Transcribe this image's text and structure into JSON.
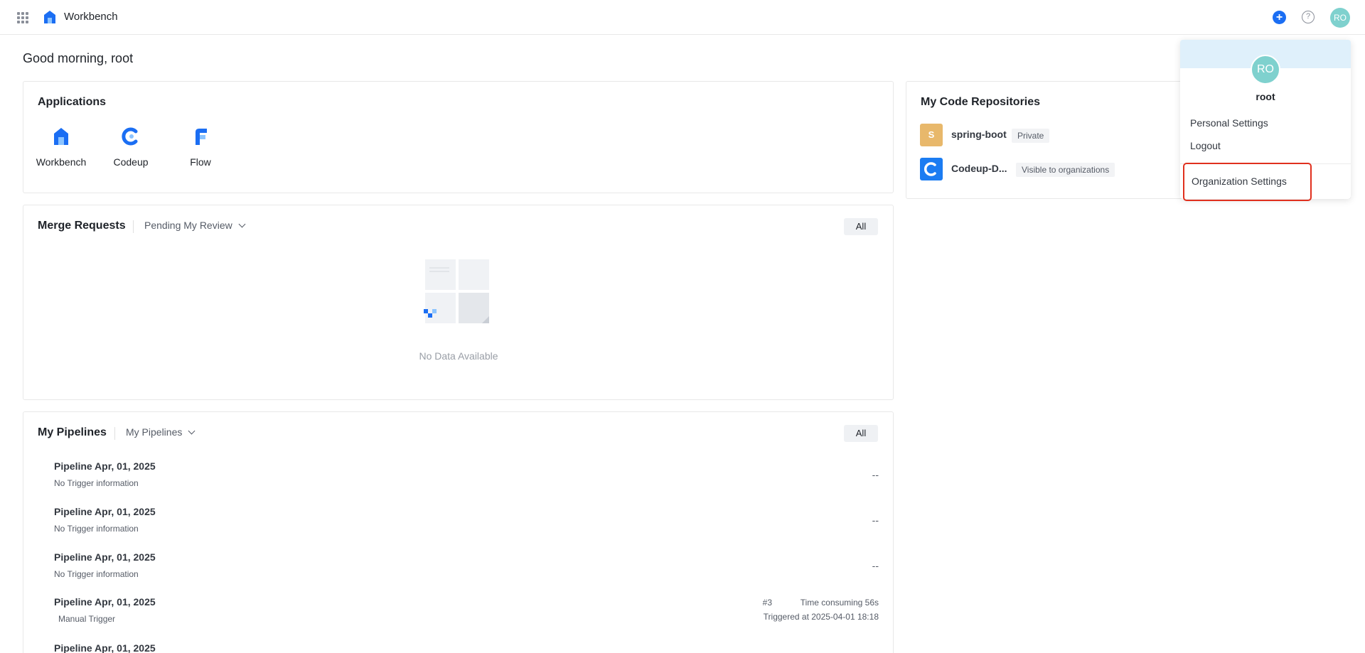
{
  "header": {
    "title": "Workbench",
    "plus_label": "+",
    "help_label": "?",
    "avatar_initials": "RO"
  },
  "greeting": "Good morning, root",
  "applications": {
    "title": "Applications",
    "items": [
      {
        "label": "Workbench",
        "icon": "workbench-icon"
      },
      {
        "label": "Codeup",
        "icon": "codeup-icon"
      },
      {
        "label": "Flow",
        "icon": "flow-icon"
      }
    ]
  },
  "merge_requests": {
    "title": "Merge Requests",
    "filter": "Pending My Review",
    "all_label": "All",
    "empty_text": "No Data Available"
  },
  "pipelines": {
    "title": "My Pipelines",
    "filter": "My Pipelines",
    "all_label": "All",
    "rows": [
      {
        "name": "Pipeline Apr, 01, 2025",
        "trigger": "No Trigger information",
        "status": "--"
      },
      {
        "name": "Pipeline Apr, 01, 2025",
        "trigger": "No Trigger information",
        "status": "--"
      },
      {
        "name": "Pipeline Apr, 01, 2025",
        "trigger": "No Trigger information",
        "status": "--"
      },
      {
        "name": "Pipeline Apr, 01, 2025",
        "trigger": "Manual Trigger",
        "run_number": "#3",
        "time_consuming": "Time consuming 56s",
        "triggered_at": "Triggered at 2025-04-01 18:18"
      },
      {
        "name": "Pipeline Apr, 01, 2025"
      }
    ]
  },
  "repositories": {
    "title": "My Code Repositories",
    "items": [
      {
        "initial": "S",
        "name": "spring-boot",
        "visibility": "Private",
        "color": "#e8b86b"
      },
      {
        "initial": "C",
        "name": "Codeup-D...",
        "visibility": "Visible to organizations",
        "color": "#1b7cf2"
      }
    ]
  },
  "user_menu": {
    "avatar_initials": "RO",
    "username": "root",
    "personal_settings": "Personal Settings",
    "logout": "Logout",
    "organization_settings": "Organization Settings"
  },
  "colors": {
    "accent": "#1b6ef3",
    "avatar": "#7fd1ce",
    "highlight": "#e0301e"
  }
}
